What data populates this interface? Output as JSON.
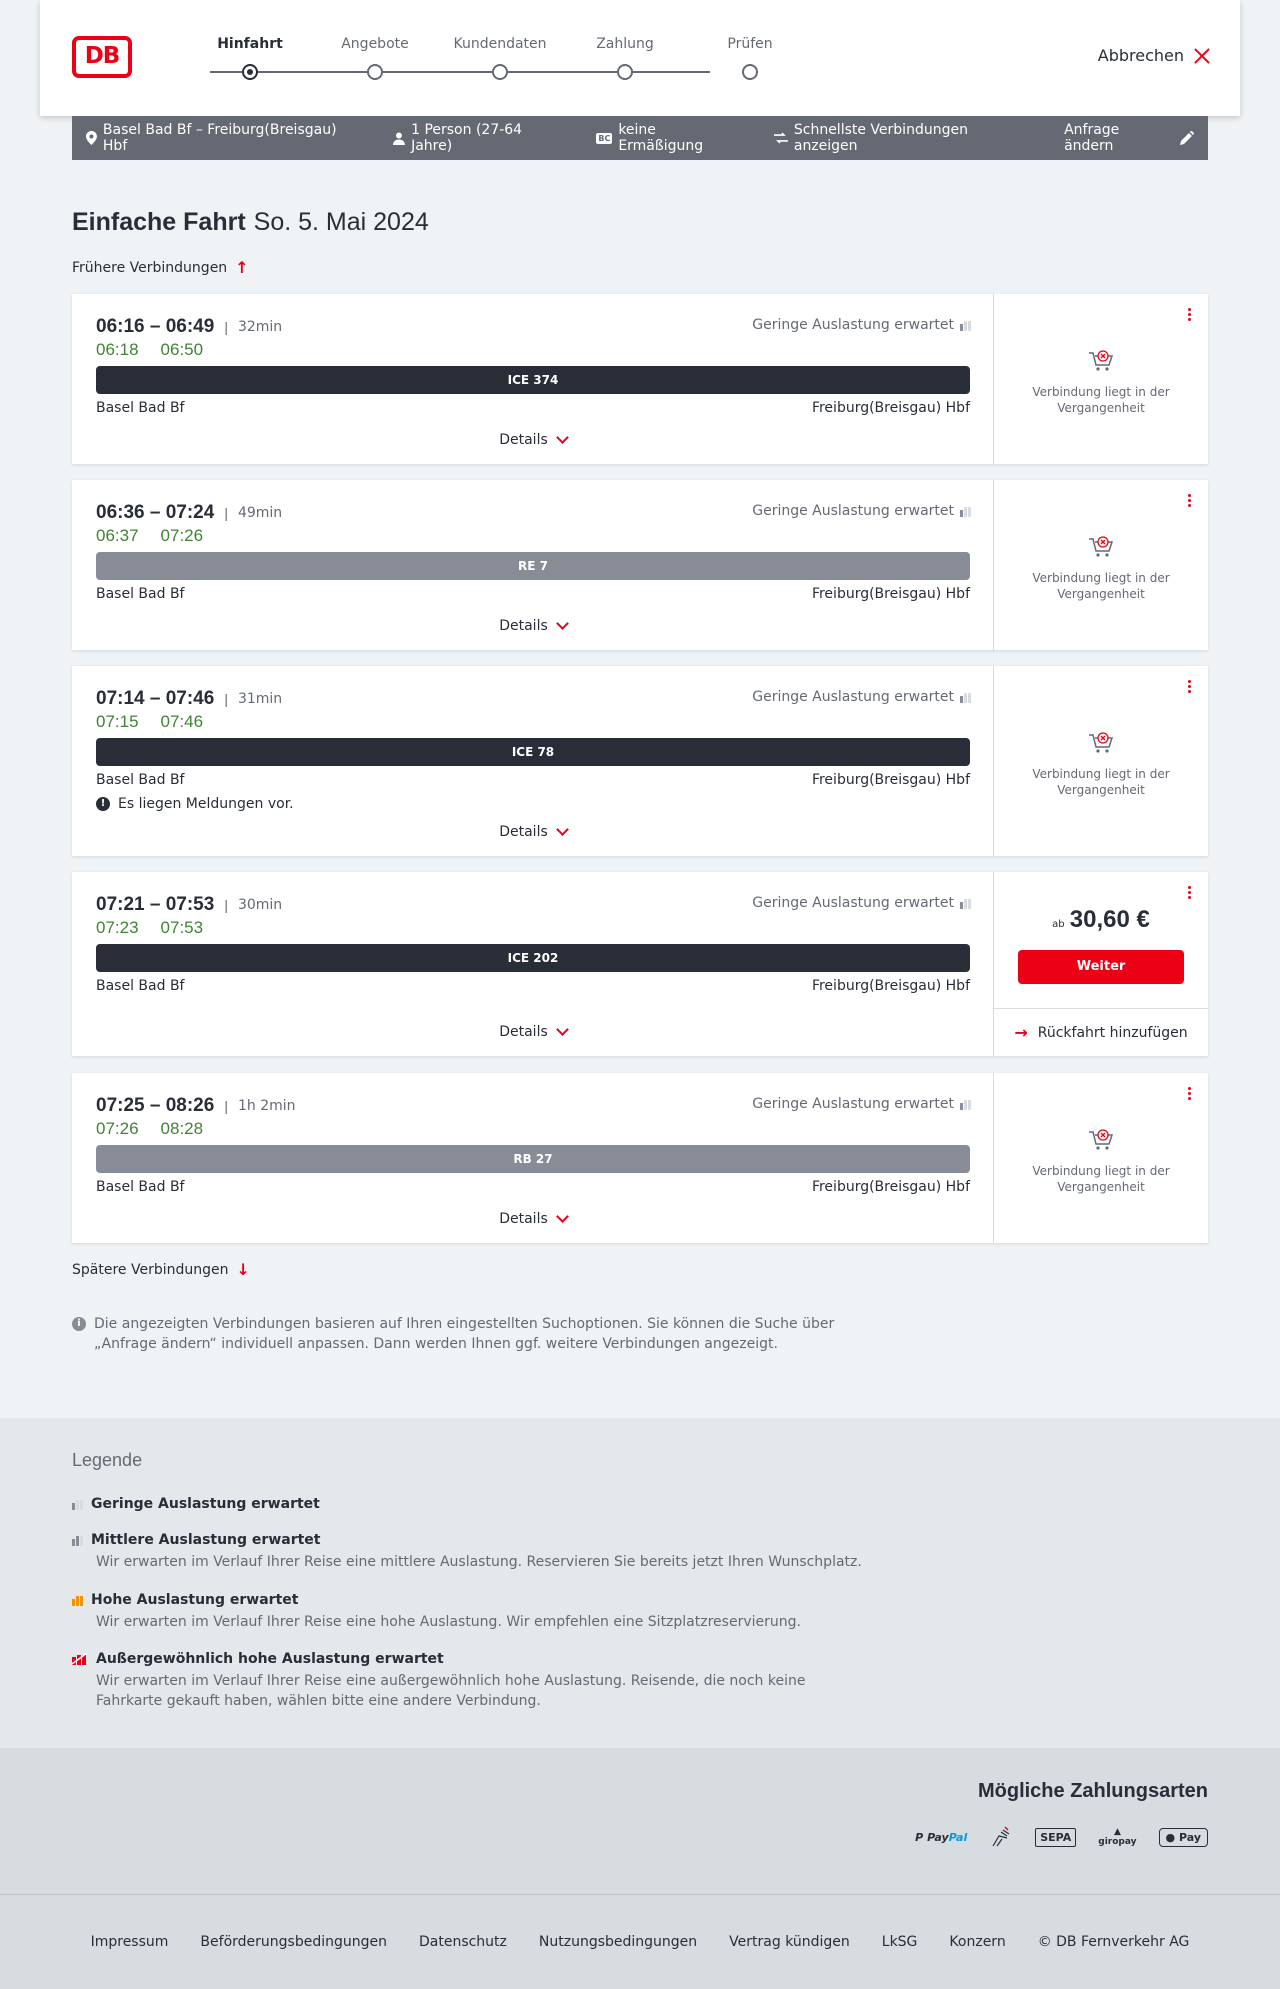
{
  "header": {
    "logo_text": "DB",
    "steps": [
      "Hinfahrt",
      "Angebote",
      "Kundendaten",
      "Zahlung",
      "Prüfen"
    ],
    "active_step": "Hinfahrt",
    "cancel_label": "Abbrechen"
  },
  "summary": {
    "route": "Basel Bad Bf – Freiburg(Breisgau) Hbf",
    "travellers": "1 Person (27-64 Jahre)",
    "bc_badge": "BC",
    "discount": "keine Ermäßigung",
    "mode": "Schnellste Verbindungen anzeigen",
    "change_label": "Anfrage ändern"
  },
  "title": {
    "main": "Einfache Fahrt",
    "date": "So. 5. Mai 2024"
  },
  "earlier_label": "Frühere Verbindungen",
  "later_label": "Spätere Verbindungen",
  "details_label": "Details",
  "load_label": "Geringe Auslastung erwartet",
  "connections": [
    {
      "time": "06:16 – 06:49",
      "duration": "32min",
      "rt_dep": "06:18",
      "rt_arr": "06:50",
      "train": "ICE 374",
      "from": "Basel Bad Bf",
      "to": "Freiburg(Breisgau) Hbf",
      "status": "Verbindung liegt in der Vergangenheit"
    },
    {
      "time": "06:36 – 07:24",
      "duration": "49min",
      "rt_dep": "06:37",
      "rt_arr": "07:26",
      "train": "RE 7",
      "from": "Basel Bad Bf",
      "to": "Freiburg(Breisgau) Hbf",
      "status": "Verbindung liegt in der Vergangenheit"
    },
    {
      "time": "07:14 – 07:46",
      "duration": "31min",
      "rt_dep": "07:15",
      "rt_arr": "07:46",
      "train": "ICE 78",
      "from": "Basel Bad Bf",
      "to": "Freiburg(Breisgau) Hbf",
      "note": "Es liegen Meldungen vor.",
      "status": "Verbindung liegt in der Vergangenheit"
    },
    {
      "time": "07:21 – 07:53",
      "duration": "30min",
      "rt_dep": "07:23",
      "rt_arr": "07:53",
      "train": "ICE 202",
      "from": "Basel Bad Bf",
      "to": "Freiburg(Breisgau) Hbf",
      "price_prefix": "ab",
      "price": "30,60 €",
      "button": "Weiter",
      "return_label": "Rückfahrt hinzufügen"
    },
    {
      "time": "07:25 – 08:26",
      "duration": "1h 2min",
      "rt_dep": "07:26",
      "rt_arr": "08:28",
      "train": "RB 27",
      "from": "Basel Bad Bf",
      "to": "Freiburg(Breisgau) Hbf",
      "status": "Verbindung liegt in der Vergangenheit"
    }
  ],
  "info_text": "Die angezeigten Verbindungen basieren auf Ihren eingestellten Suchoptionen. Sie können die Suche über „Anfrage ändern“ individuell anpassen. Dann werden Ihnen ggf. weitere Verbindungen angezeigt.",
  "legend": {
    "title": "Legende",
    "items": [
      {
        "title": "Geringe Auslastung erwartet",
        "desc": "",
        "color": "#878c96"
      },
      {
        "title": "Mittlere Auslastung erwartet",
        "desc": "Wir erwarten im Verlauf Ihrer Reise eine mittlere Auslastung. Reservieren Sie bereits jetzt Ihren Wunschplatz.",
        "color": "#646973"
      },
      {
        "title": "Hohe Auslastung erwartet",
        "desc": "Wir erwarten im Verlauf Ihrer Reise eine hohe Auslastung. Wir empfehlen eine Sitzplatzreservierung.",
        "color": "#f39200"
      },
      {
        "title": "Außergewöhnlich hohe Auslastung erwartet",
        "desc": "Wir erwarten im Verlauf Ihrer Reise eine außergewöhnlich hohe Auslastung. Reisende, die noch keine Fahrkarte gekauft haben, wählen bitte eine andere Verbindung.",
        "color": "#ec0016"
      }
    ]
  },
  "payment": {
    "title": "Mögliche Zahlungsarten",
    "methods": {
      "paypal_a": "Pay",
      "paypal_b": "Pal",
      "sepa": "SEPA",
      "giropay": "giropay",
      "applepay": " Pay"
    }
  },
  "footer": [
    "Impressum",
    "Beförderungsbedingungen",
    "Datenschutz",
    "Nutzungsbedingungen",
    "Vertrag kündigen",
    "LkSG",
    "Konzern",
    "© DB Fernverkehr AG"
  ],
  "colors": {
    "brand_red": "#ec0016",
    "realtime_green": "#408335",
    "dark": "#282d37",
    "grey": "#646973"
  }
}
